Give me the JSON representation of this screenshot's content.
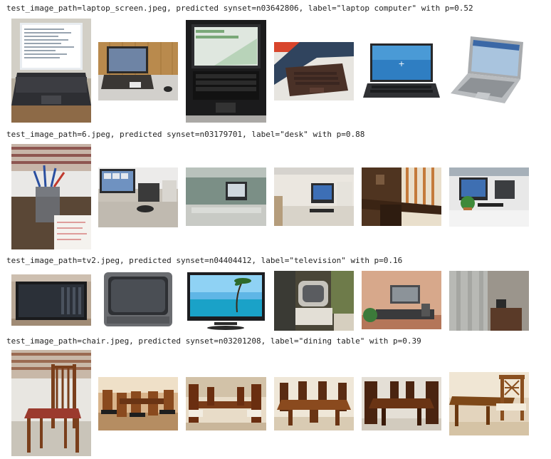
{
  "rows": [
    {
      "caption": "test_image_path=laptop_screen.jpeg, predicted synset=n03642806, label=\"laptop computer\" with p=0.52",
      "thumb_names": [
        "query-laptop-screen-photo",
        "laptop-on-desk-photo",
        "black-laptop-photo",
        "brown-laptop-photo",
        "blue-screen-laptop-photo",
        "silver-laptop-photo"
      ]
    },
    {
      "caption": "test_image_path=6.jpeg, predicted synset=n03179701, label=\"desk\" with p=0.88",
      "thumb_names": [
        "query-pencil-cup-desk-photo",
        "desk-with-monitor-photo",
        "office-cubicle-photo",
        "workstation-desk-photo",
        "wooden-corner-desk-photo",
        "office-desk-with-plant-photo"
      ]
    },
    {
      "caption": "test_image_path=tv2.jpeg, predicted synset=n04404412, label=\"television\" with p=0.16",
      "thumb_names": [
        "query-flat-tv-photo",
        "crt-television-photo",
        "flat-tv-beach-screen-photo",
        "retro-tv-photo",
        "tv-stand-living-room-photo",
        "dim-room-tv-photo"
      ]
    },
    {
      "caption": "test_image_path=chair.jpeg, predicted synset=n03201208, label=\"dining table\" with p=0.39",
      "thumb_names": [
        "query-wooden-chair-photo",
        "dining-room-chairs-photo",
        "dining-table-set-photo",
        "carved-dining-table-photo",
        "dark-dining-table-photo",
        "dining-chairs-corner-photo"
      ]
    }
  ]
}
